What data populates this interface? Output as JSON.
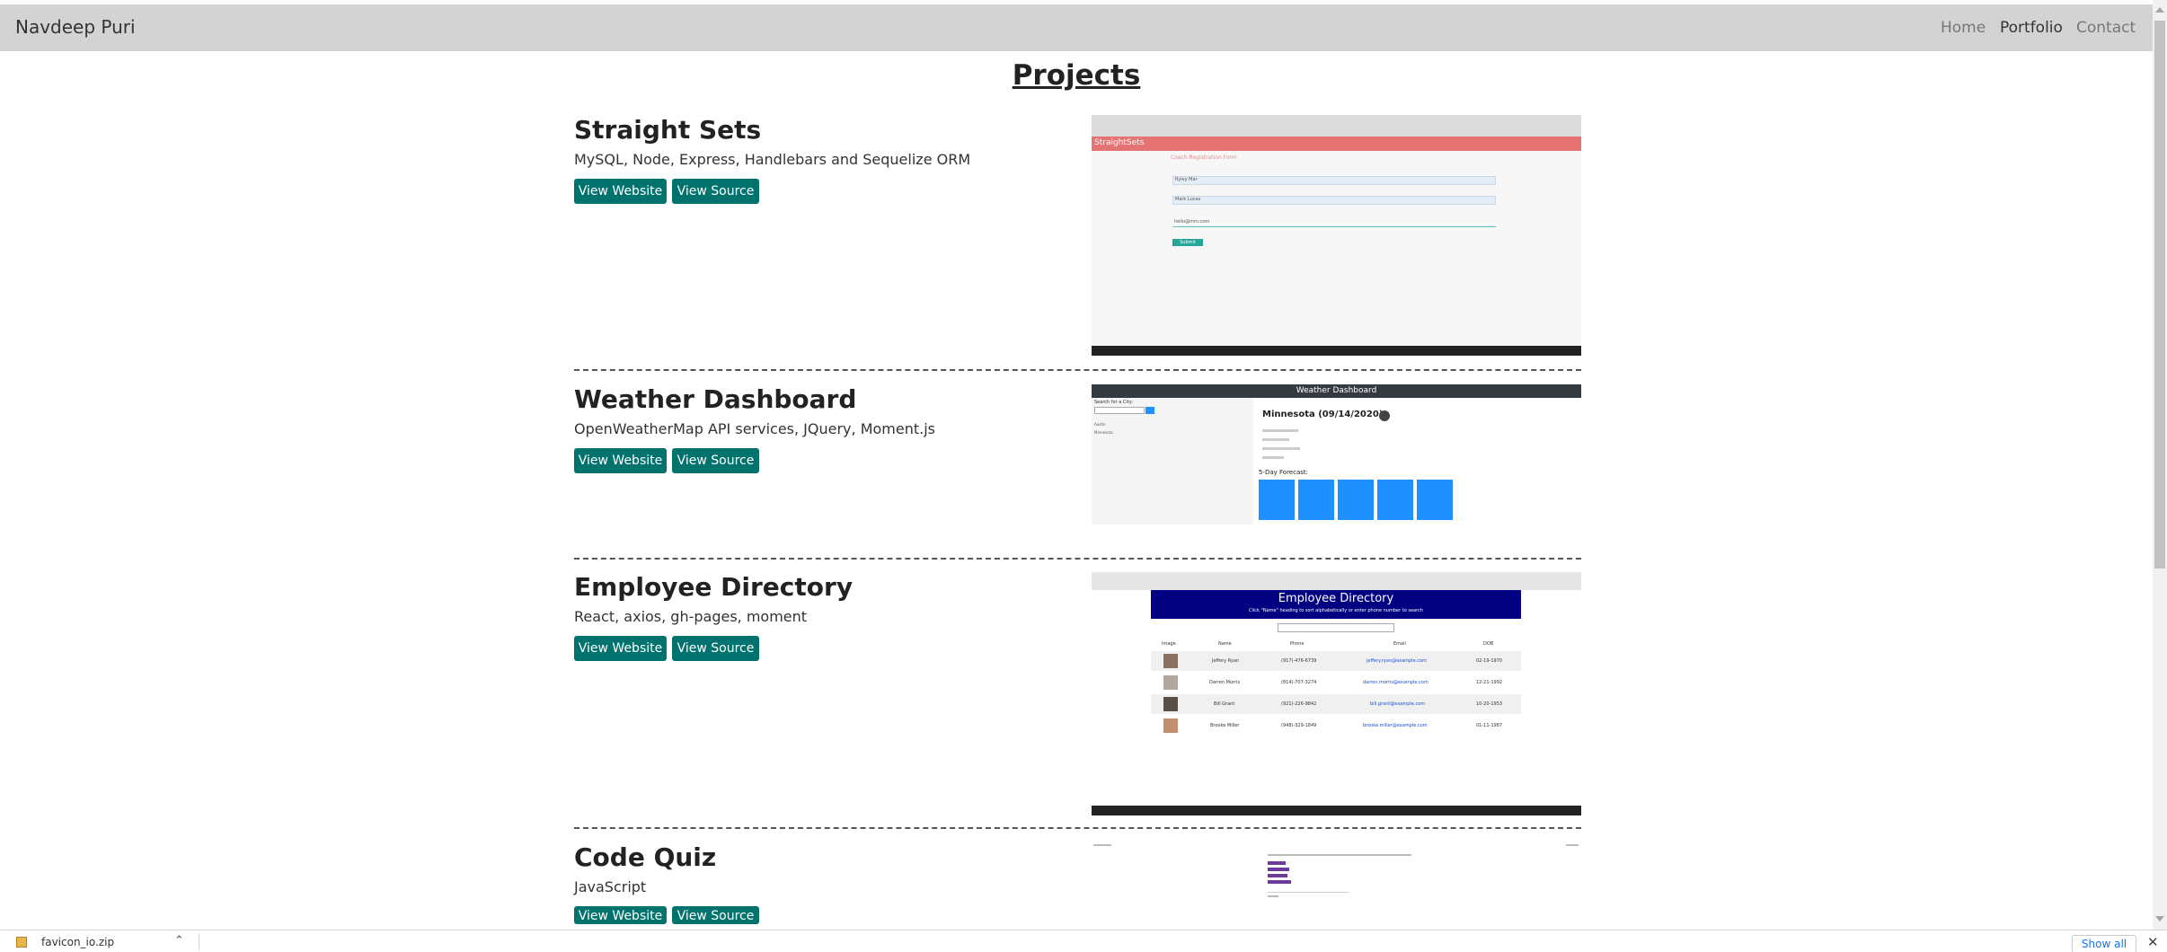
{
  "navbar": {
    "brand": "Navdeep Puri",
    "links": [
      {
        "label": "Home"
      },
      {
        "label": "Portfolio"
      },
      {
        "label": "Contact"
      }
    ]
  },
  "page_title": "Projects",
  "projects": [
    {
      "name": "Straight Sets",
      "tech": "MySQL, Node, Express, Handlebars and Sequelize ORM",
      "website_label": "View Website",
      "source_label": "View Source",
      "thumbnail": {
        "header": "StraightSets",
        "form_title": "Coach Registration Form",
        "fields": [
          "Ryley Mar",
          "Mark Lucas",
          "hello@mm.com"
        ],
        "button": "Submit"
      }
    },
    {
      "name": "Weather Dashboard",
      "tech": "OpenWeatherMap API services, JQuery, Moment.js",
      "website_label": "View Website",
      "source_label": "View Source",
      "thumbnail": {
        "header": "Weather Dashboard",
        "search_label": "Search for a City:",
        "city": "Minnesota (09/14/2020)",
        "forecast_label": "5-Day Forecast:",
        "cities": [
          "Austin",
          "Minnesota"
        ]
      }
    },
    {
      "name": "Employee Directory",
      "tech": "React, axios, gh-pages, moment",
      "website_label": "View Website",
      "source_label": "View Source",
      "thumbnail": {
        "header": "Employee Directory",
        "subheader": "Click \"Name\" heading to sort alphabetically or enter phone number to search",
        "columns": [
          "Image",
          "Name",
          "Phone",
          "Email",
          "DOB"
        ],
        "rows": [
          [
            "Jeffery Ryan",
            "(917)-476-6739",
            "jeffery.ryan@example.com",
            "02-19-1970"
          ],
          [
            "Darren Morris",
            "(814)-707-3274",
            "darren.morris@example.com",
            "12-21-1992"
          ],
          [
            "Bill Grant",
            "(921)-226-9842",
            "bill.grant@example.com",
            "10-20-1953"
          ],
          [
            "Brooke Miller",
            "(948)-329-1849",
            "brooke.miller@example.com",
            "01-11-1987"
          ]
        ]
      }
    },
    {
      "name": "Code Quiz",
      "tech": "JavaScript",
      "website_label": "View Website",
      "source_label": "View Source",
      "thumbnail": {}
    }
  ],
  "download_bar": {
    "file_name": "favicon_io.zip",
    "show_all_label": "Show all"
  },
  "colors": {
    "navbar_bg": "#d3d3d3",
    "button_bg": "#00736e",
    "straightsets_header": "#e57373",
    "employee_header": "#000080",
    "weather_tile": "#1e90ff"
  }
}
